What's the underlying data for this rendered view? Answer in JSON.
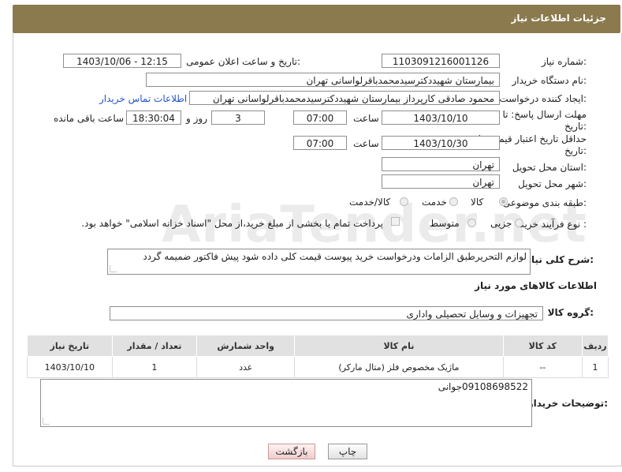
{
  "header": {
    "title": "جزئیات اطلاعات نیاز"
  },
  "fields": {
    "need_number_label": "شماره نیاز:",
    "need_number": "1103091216001126",
    "announce_label": "تاریخ و ساعت اعلان عمومی:",
    "announce_value": "1403/10/06 - 12:15",
    "buyer_label": "نام دستگاه خریدار:",
    "buyer_value": "بیمارستان شهیددکترسیدمحمدباقرلواسانی تهران",
    "creator_label": "ایجاد کننده درخواست:",
    "creator_value": "محمود صادقی کارپرداز بیمارستان شهیددکترسیدمحمدباقرلواسانی تهران",
    "contact_link": "اطلاعات تماس خریدار",
    "deadline_label_1": "مهلت ارسال پاسخ: تا",
    "deadline_label_2": "تاریخ:",
    "deadline_date": "1403/10/10",
    "time_label": "ساعت",
    "deadline_time": "07:00",
    "days_value": "3",
    "days_label": "روز و",
    "remaining_time": "18:30:04",
    "remaining_label": "ساعت باقی مانده",
    "validity_label_1": "حداقل تاریخ اعتبار قیمت: تا",
    "validity_label_2": "تاریخ:",
    "validity_date": "1403/10/30",
    "validity_time_label": "ساعت",
    "validity_time": "07:00",
    "province_label": "استان محل تحویل:",
    "province_value": "تهران",
    "city_label": "شهر محل تحویل:",
    "city_value": "تهران",
    "category_label": "طبقه بندی موضوعی:",
    "category_options": [
      "کالا",
      "خدمت",
      "کالا/خدمت"
    ],
    "process_label": "نوع فرآیند خرید :",
    "process_options": [
      "جزیی",
      "متوسط"
    ],
    "payment_note": "پرداخت تمام یا بخشی از مبلغ خرید،از محل \"اسناد خزانه اسلامی\" خواهد بود.",
    "description_label": "شرح کلی نیاز:",
    "description_value": "لوازم التحریرطبق الزامات ودرخواست خرید پیوست قیمت کلی داده شود پیش فاکتور ضمیمه گردد",
    "items_section_title": "اطلاعات کالاهای مورد نیاز",
    "group_label": "گروه کالا:",
    "group_value": "تجهیزات و وسایل تحصیلی واداری",
    "buyer_notes_label": "توضیحات خریدار:",
    "buyer_notes_value": "09108698522جوانی"
  },
  "table": {
    "headers": [
      "ردیف",
      "کد کالا",
      "نام کالا",
      "واحد شمارش",
      "تعداد / مقدار",
      "تاریخ نیاز"
    ],
    "rows": [
      [
        "1",
        "--",
        "ماژیک مخصوص فلز (متال مارکر)",
        "عدد",
        "1",
        "1403/10/10"
      ]
    ]
  },
  "buttons": {
    "print": "چاپ",
    "back": "بازگشت"
  },
  "watermark": "AriaTender.net"
}
